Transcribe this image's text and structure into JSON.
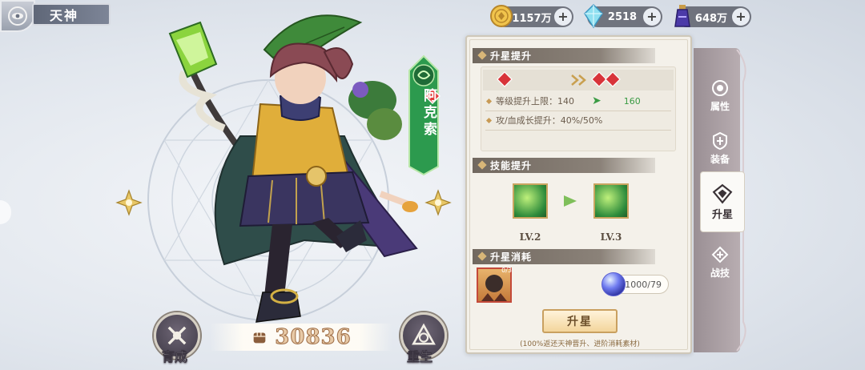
{
  "header": {
    "title": "天神"
  },
  "currencies": [
    {
      "icon": "gold-coin-icon",
      "value": "1157万",
      "plus": "+"
    },
    {
      "icon": "blue-crystal-icon",
      "value": "2518",
      "plus": "+"
    },
    {
      "icon": "potion-bottle-icon",
      "value": "648万",
      "plus": "+"
    }
  ],
  "hero": {
    "name": "阿克索",
    "power": "30836"
  },
  "actions": {
    "cultivate": "育成",
    "rebirth": "重生"
  },
  "panel": {
    "star_up": {
      "title": "升星提升",
      "stats": [
        {
          "label": "等级提升上限：140",
          "arrow": "➤",
          "value": "160"
        },
        {
          "label": "攻/血成长提升：40%/50%"
        }
      ]
    },
    "skill_up": {
      "title": "技能提升",
      "from_level": "LV.2",
      "to_level": "LV.3"
    },
    "cost": {
      "title": "升星消耗",
      "item_badge": "0/3",
      "orb_count": "1000/79"
    },
    "button_label": "升星",
    "hint": "(100%返还天神晋升、进阶消耗素材)"
  },
  "tabs": [
    {
      "label": "属性",
      "icon": "attribute-icon"
    },
    {
      "label": "装备",
      "icon": "equipment-icon"
    },
    {
      "label": "升星",
      "icon": "star-up-icon",
      "active": true
    },
    {
      "label": "战技",
      "icon": "battle-skill-icon"
    }
  ],
  "colors": {
    "accent_green": "#3a9b44",
    "panel_bg": "#f4f1ea",
    "header_brown": "#71685f",
    "ruby": "#d8343a"
  }
}
